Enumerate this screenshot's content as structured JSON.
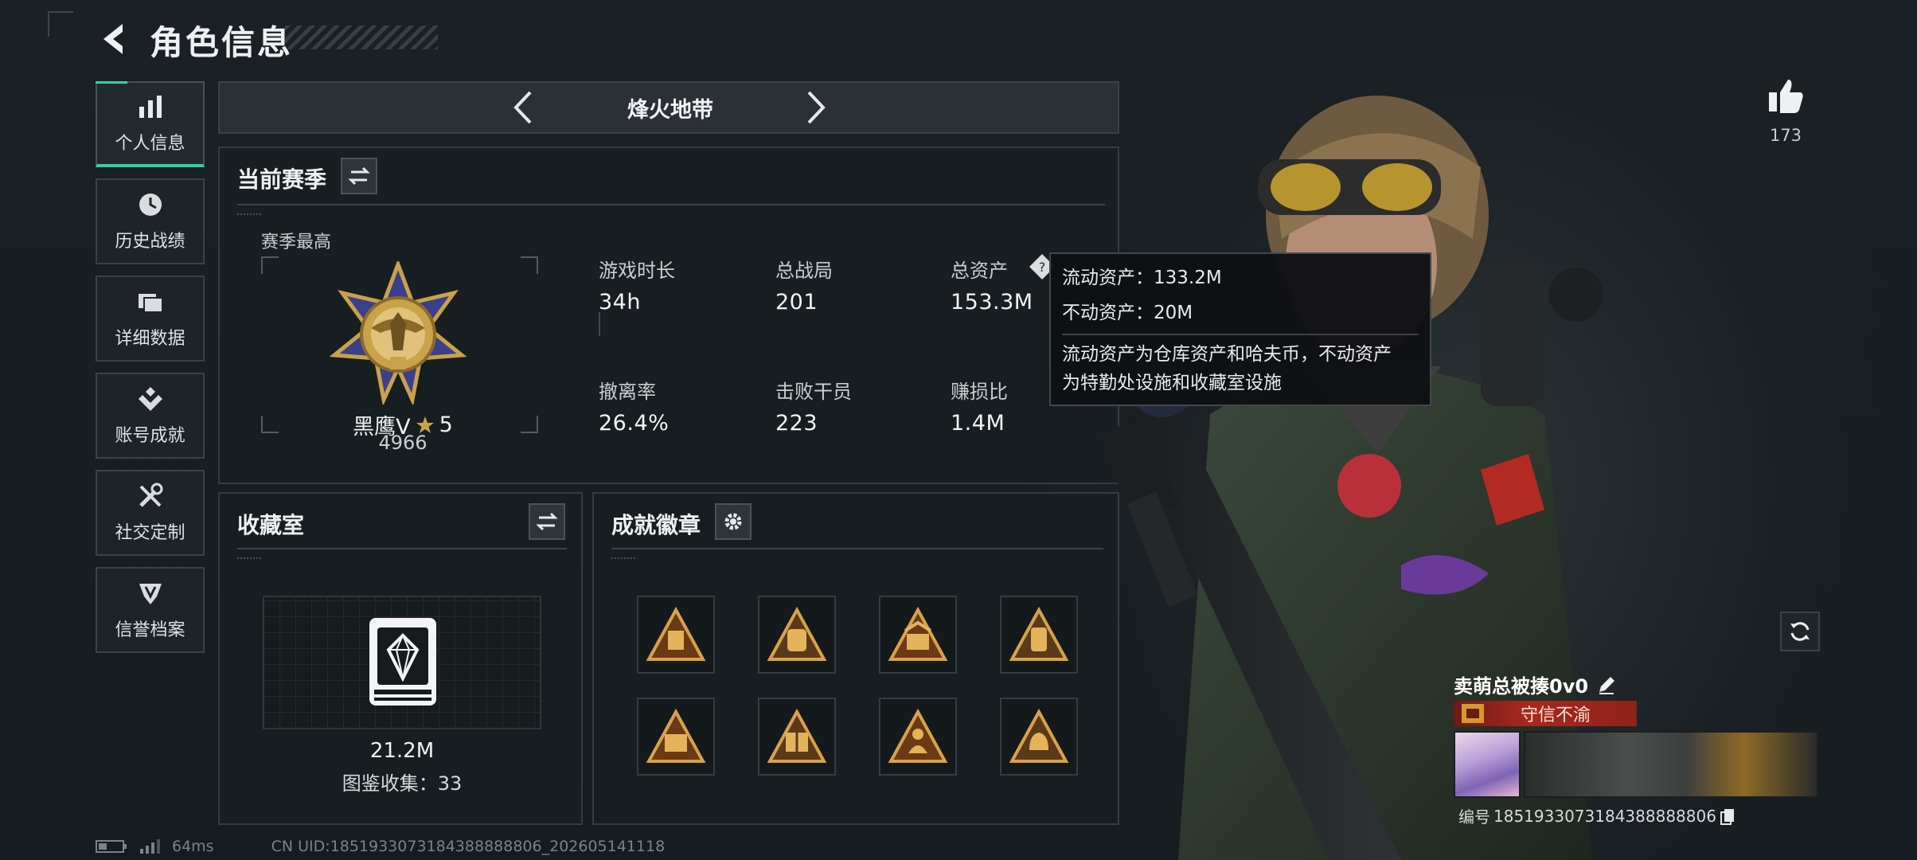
{
  "header": {
    "title": "角色信息",
    "back_icon": "chevron-left-icon"
  },
  "sidebar": {
    "items": [
      {
        "label": "个人信息",
        "icon": "bar-chart-icon",
        "active": true
      },
      {
        "label": "历史战绩",
        "icon": "clock-icon",
        "active": false
      },
      {
        "label": "详细数据",
        "icon": "folder-icon",
        "active": false
      },
      {
        "label": "账号成就",
        "icon": "achievement-icon",
        "active": false
      },
      {
        "label": "社交定制",
        "icon": "tools-icon",
        "active": false
      },
      {
        "label": "信誉档案",
        "icon": "credit-shield-icon",
        "active": false
      }
    ]
  },
  "mode": {
    "label": "烽火地带"
  },
  "season": {
    "title": "当前赛季",
    "best_label": "赛季最高",
    "rank_name": "黑鹰Ⅴ",
    "rank_stars": "5",
    "rank_score": "4966",
    "stats": [
      {
        "label": "游戏时长",
        "value": "34h"
      },
      {
        "label": "总战局",
        "value": "201"
      },
      {
        "label": "总资产",
        "value": "153.3M"
      },
      {
        "label": "撤离率",
        "value": "26.4%"
      },
      {
        "label": "击败干员",
        "value": "223"
      },
      {
        "label": "赚损比",
        "value": "1.4M"
      }
    ]
  },
  "tooltip": {
    "liquid": "流动资产：133.2M",
    "fixed": "不动资产：20M",
    "desc_line1": "流动资产为仓库资产和哈夫币，不动资产",
    "desc_line2": "为特勤处设施和收藏室设施"
  },
  "collection": {
    "title": "收藏室",
    "value": "21.2M",
    "catalog": "图鉴收集：33"
  },
  "achievements": {
    "title": "成就徽章",
    "badge_count": 8,
    "badges": [
      "badge-bag-icon",
      "badge-backpack-icon",
      "badge-rank-icon",
      "badge-pack-icon",
      "badge-50-icon",
      "badge-gift-icon",
      "badge-soldier-icon",
      "badge-hand-icon"
    ]
  },
  "likes": {
    "count": "173",
    "icon": "thumbs-up-icon"
  },
  "player": {
    "name": "卖萌总被揍0v0",
    "honor": "守信不渝",
    "uid_label": "编号",
    "uid": "1851933073184388888806"
  },
  "status": {
    "ping": "64ms",
    "uid_line": "CN UID:1851933073184388888806_202605141118"
  },
  "colors": {
    "accent": "#2fd3a4",
    "gold": "#c9a24a",
    "honor_red": "#a8281f"
  }
}
